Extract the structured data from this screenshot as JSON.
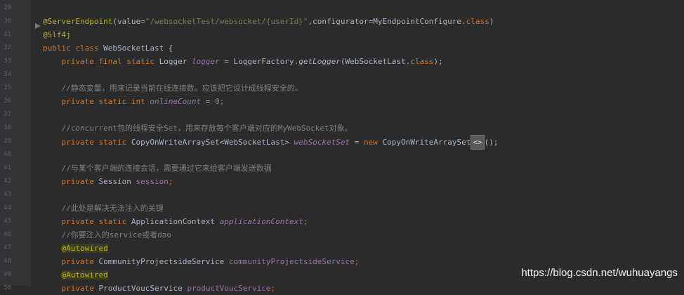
{
  "editor": {
    "line_numbers": [
      "29",
      "30",
      "31",
      "32",
      "33",
      "34",
      "35",
      "36",
      "37",
      "38",
      "39",
      "40",
      "41",
      "42",
      "43",
      "44",
      "45",
      "46",
      "47",
      "48",
      "49"
    ],
    "lines": [
      {
        "n": "29",
        "parts": []
      },
      {
        "n": "30",
        "parts": [
          {
            "t": "@ServerEndpoint",
            "c": "ann"
          },
          {
            "t": "(value=",
            "c": ""
          },
          {
            "t": "\"/websocketTest/websocket/{userId}\"",
            "c": "str"
          },
          {
            "t": ",configurator=MyEndpointConfigure.",
            "c": ""
          },
          {
            "t": "class",
            "c": "kw"
          },
          {
            "t": ")",
            "c": ""
          }
        ]
      },
      {
        "n": "31",
        "parts": [
          {
            "t": "@Slf4j",
            "c": "ann"
          }
        ]
      },
      {
        "n": "32",
        "parts": [
          {
            "t": "public class ",
            "c": "kw"
          },
          {
            "t": "WebSocketLast {",
            "c": ""
          }
        ]
      },
      {
        "n": "33",
        "parts": [
          {
            "t": "    private final static ",
            "c": "kw"
          },
          {
            "t": "Logger ",
            "c": ""
          },
          {
            "t": "logger",
            "c": "fieldi"
          },
          {
            "t": " = LoggerFactory.",
            "c": ""
          },
          {
            "t": "getLogger",
            "c": "methi"
          },
          {
            "t": "(WebSocketLast.",
            "c": ""
          },
          {
            "t": "class",
            "c": "kw"
          },
          {
            "t": ");",
            "c": ""
          }
        ]
      },
      {
        "n": "34",
        "parts": []
      },
      {
        "n": "35",
        "parts": [
          {
            "t": "    //静态变量，用来记录当前在线连接数。应该把它设计成线程安全的。",
            "c": "cmt"
          }
        ]
      },
      {
        "n": "36",
        "parts": [
          {
            "t": "    private static int ",
            "c": "kw"
          },
          {
            "t": "onlineCount",
            "c": "fieldi"
          },
          {
            "t": " = ",
            "c": ""
          },
          {
            "t": "0",
            "c": "num"
          },
          {
            "t": ";",
            "c": "kw"
          }
        ]
      },
      {
        "n": "37",
        "parts": []
      },
      {
        "n": "38",
        "parts": [
          {
            "t": "    //concurrent包的线程安全Set，用来存放每个客户端对应的MyWebSocket对象。",
            "c": "cmt"
          }
        ]
      },
      {
        "n": "39",
        "parts": [
          {
            "t": "    private static ",
            "c": "kw"
          },
          {
            "t": "CopyOnWriteArraySet<WebSocketLast> ",
            "c": ""
          },
          {
            "t": "webSocketSet",
            "c": "fieldi"
          },
          {
            "t": " = ",
            "c": ""
          },
          {
            "t": "new ",
            "c": "kw"
          },
          {
            "t": "CopyOnWriteArraySet",
            "c": ""
          },
          {
            "t": "<>",
            "c": "diamond"
          },
          {
            "t": "();",
            "c": ""
          }
        ]
      },
      {
        "n": "40",
        "parts": []
      },
      {
        "n": "41",
        "parts": [
          {
            "t": "    //与某个客户端的连接会话，需要通过它来给客户端发送数据",
            "c": "cmt"
          }
        ]
      },
      {
        "n": "42",
        "parts": [
          {
            "t": "    private ",
            "c": "kw"
          },
          {
            "t": "Session ",
            "c": ""
          },
          {
            "t": "session",
            "c": "field"
          },
          {
            "t": ";",
            "c": "kw"
          }
        ]
      },
      {
        "n": "43",
        "parts": []
      },
      {
        "n": "44",
        "parts": [
          {
            "t": "    //此处是解决无法注入的关键",
            "c": "cmt"
          }
        ]
      },
      {
        "n": "45",
        "parts": [
          {
            "t": "    private static ",
            "c": "kw"
          },
          {
            "t": "ApplicationContext ",
            "c": ""
          },
          {
            "t": "applicationContext",
            "c": "fieldi"
          },
          {
            "t": ";",
            "c": "kw"
          }
        ]
      },
      {
        "n": "46",
        "parts": [
          {
            "t": "    //你要注入的service或者dao",
            "c": "cmt"
          }
        ]
      },
      {
        "n": "47",
        "parts": [
          {
            "t": "    ",
            "c": ""
          },
          {
            "t": "@Autowired",
            "c": "ann-hl"
          }
        ]
      },
      {
        "n": "48",
        "parts": [
          {
            "t": "    private ",
            "c": "kw"
          },
          {
            "t": "CommunityProjectsideService ",
            "c": ""
          },
          {
            "t": "communityProjectsideService",
            "c": "field"
          },
          {
            "t": ";",
            "c": "kw"
          }
        ]
      },
      {
        "n": "49",
        "parts": [
          {
            "t": "    ",
            "c": ""
          },
          {
            "t": "@Autowired",
            "c": "ann-hl"
          }
        ]
      },
      {
        "n": "50",
        "parts": [
          {
            "t": "    private ",
            "c": "kw"
          },
          {
            "t": "ProductVoucService ",
            "c": ""
          },
          {
            "t": "productVoucService",
            "c": "field"
          },
          {
            "t": ";",
            "c": "kw"
          }
        ]
      }
    ]
  },
  "watermark": "https://blog.csdn.net/wuhuayangs",
  "colors": {
    "background": "#2b2b2b",
    "keyword": "#cc7832",
    "annotation": "#bbb529",
    "string": "#6a8759",
    "comment": "#808080",
    "field": "#9876aa",
    "number": "#6897bb"
  }
}
